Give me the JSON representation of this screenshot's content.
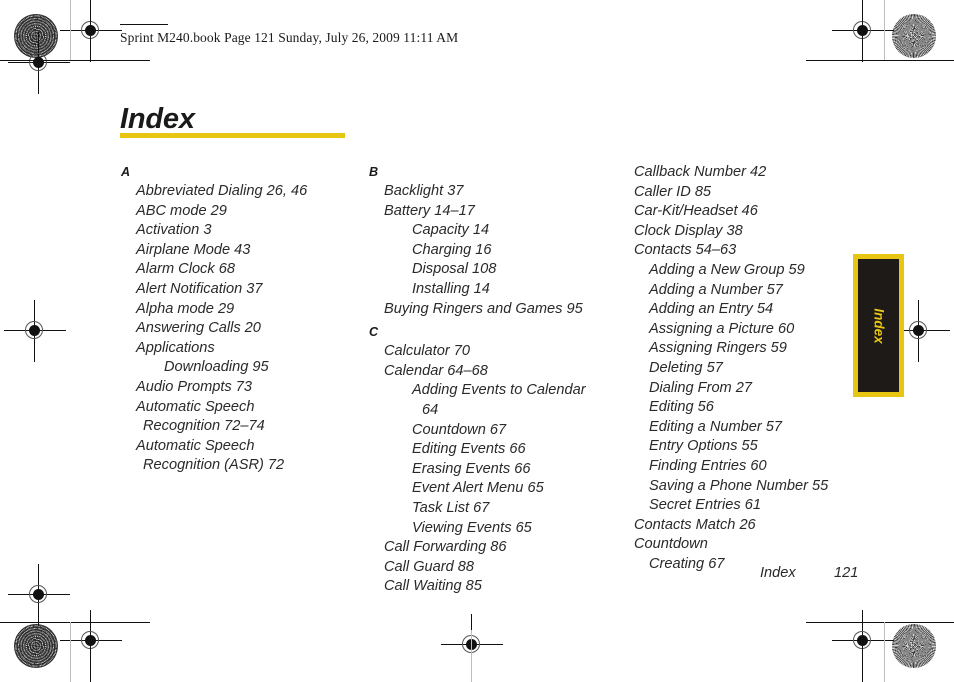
{
  "header": {
    "text": "Sprint M240.book  Page 121  Sunday, July 26, 2009  11:11 AM"
  },
  "title": "Index",
  "accent_color": "#e8c511",
  "tab": {
    "label": "Index",
    "background_color": "#1e1a17",
    "border_color": "#e8c511"
  },
  "footer": {
    "label": "Index",
    "page_number": "121"
  },
  "columns": [
    {
      "id": "column-1",
      "blocks": [
        {
          "type": "letter",
          "text": "A"
        },
        {
          "type": "entry",
          "level": 1,
          "text": "Abbreviated Dialing 26, 46"
        },
        {
          "type": "entry",
          "level": 1,
          "text": "ABC mode 29"
        },
        {
          "type": "entry",
          "level": 1,
          "text": "Activation 3"
        },
        {
          "type": "entry",
          "level": 1,
          "text": "Airplane Mode 43"
        },
        {
          "type": "entry",
          "level": 1,
          "text": "Alarm Clock 68"
        },
        {
          "type": "entry",
          "level": 1,
          "text": "Alert Notification 37"
        },
        {
          "type": "entry",
          "level": 1,
          "text": "Alpha mode 29"
        },
        {
          "type": "entry",
          "level": 1,
          "text": "Answering Calls 20"
        },
        {
          "type": "entry",
          "level": 1,
          "text": "Applications"
        },
        {
          "type": "entry",
          "level": 2,
          "text": "Downloading 95"
        },
        {
          "type": "entry",
          "level": 1,
          "text": "Audio Prompts 73"
        },
        {
          "type": "entry",
          "level": 1,
          "text": "Automatic Speech"
        },
        {
          "type": "entry",
          "level": 1,
          "continuation": true,
          "text": "Recognition 72–74"
        },
        {
          "type": "entry",
          "level": 1,
          "text": "Automatic Speech"
        },
        {
          "type": "entry",
          "level": 1,
          "continuation": true,
          "text": "Recognition (ASR) 72"
        }
      ]
    },
    {
      "id": "column-2",
      "blocks": [
        {
          "type": "letter",
          "text": "B"
        },
        {
          "type": "entry",
          "level": 1,
          "text": "Backlight 37"
        },
        {
          "type": "entry",
          "level": 1,
          "text": "Battery 14–17"
        },
        {
          "type": "entry",
          "level": 2,
          "text": "Capacity 14"
        },
        {
          "type": "entry",
          "level": 2,
          "text": "Charging 16"
        },
        {
          "type": "entry",
          "level": 2,
          "text": "Disposal 108"
        },
        {
          "type": "entry",
          "level": 2,
          "text": "Installing 14"
        },
        {
          "type": "entry",
          "level": 1,
          "text": "Buying Ringers and Games 95"
        },
        {
          "type": "letter",
          "text": "C"
        },
        {
          "type": "entry",
          "level": 1,
          "text": "Calculator 70"
        },
        {
          "type": "entry",
          "level": 1,
          "text": "Calendar 64–68"
        },
        {
          "type": "entry",
          "level": 2,
          "text": "Adding Events to Calendar"
        },
        {
          "type": "entry",
          "level": 2,
          "continuation": true,
          "text": "64"
        },
        {
          "type": "entry",
          "level": 2,
          "text": "Countdown 67"
        },
        {
          "type": "entry",
          "level": 2,
          "text": "Editing Events 66"
        },
        {
          "type": "entry",
          "level": 2,
          "text": "Erasing Events 66"
        },
        {
          "type": "entry",
          "level": 2,
          "text": "Event Alert Menu 65"
        },
        {
          "type": "entry",
          "level": 2,
          "text": "Task List 67"
        },
        {
          "type": "entry",
          "level": 2,
          "text": "Viewing Events 65"
        },
        {
          "type": "entry",
          "level": 1,
          "text": "Call Forwarding 86"
        },
        {
          "type": "entry",
          "level": 1,
          "text": "Call Guard 88"
        },
        {
          "type": "entry",
          "level": 1,
          "text": "Call Waiting 85"
        }
      ]
    },
    {
      "id": "column-3",
      "blocks": [
        {
          "type": "entry",
          "level": 0,
          "text": "Callback Number 42"
        },
        {
          "type": "entry",
          "level": 0,
          "text": "Caller ID 85"
        },
        {
          "type": "entry",
          "level": 0,
          "text": "Car-Kit/Headset 46"
        },
        {
          "type": "entry",
          "level": 0,
          "text": "Clock Display 38"
        },
        {
          "type": "entry",
          "level": 0,
          "text": "Contacts 54–63"
        },
        {
          "type": "entry",
          "level": 1,
          "text": "Adding a New Group 59"
        },
        {
          "type": "entry",
          "level": 1,
          "text": "Adding a Number 57"
        },
        {
          "type": "entry",
          "level": 1,
          "text": "Adding an Entry 54"
        },
        {
          "type": "entry",
          "level": 1,
          "text": "Assigning a Picture 60"
        },
        {
          "type": "entry",
          "level": 1,
          "text": "Assigning Ringers 59"
        },
        {
          "type": "entry",
          "level": 1,
          "text": "Deleting 57"
        },
        {
          "type": "entry",
          "level": 1,
          "text": "Dialing From 27"
        },
        {
          "type": "entry",
          "level": 1,
          "text": "Editing 56"
        },
        {
          "type": "entry",
          "level": 1,
          "text": "Editing a Number 57"
        },
        {
          "type": "entry",
          "level": 1,
          "text": "Entry Options 55"
        },
        {
          "type": "entry",
          "level": 1,
          "text": "Finding Entries 60"
        },
        {
          "type": "entry",
          "level": 1,
          "text": "Saving a Phone Number 55"
        },
        {
          "type": "entry",
          "level": 1,
          "text": "Secret Entries 61"
        },
        {
          "type": "entry",
          "level": 0,
          "text": "Contacts Match 26"
        },
        {
          "type": "entry",
          "level": 0,
          "text": "Countdown"
        },
        {
          "type": "entry",
          "level": 1,
          "text": "Creating 67"
        }
      ]
    }
  ]
}
